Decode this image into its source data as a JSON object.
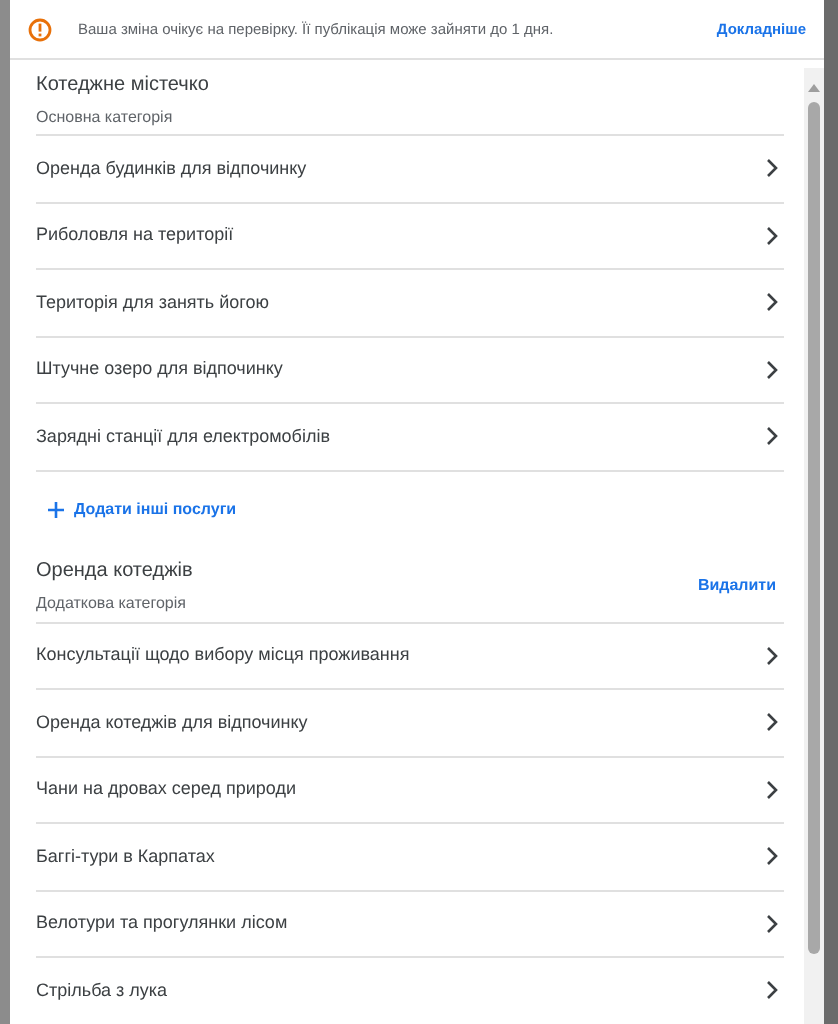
{
  "banner": {
    "message": "Ваша зміна очікує на перевірку. Її публікація може зайняти до 1 дня.",
    "link": "Докладніше"
  },
  "categories": [
    {
      "title": "Котеджне містечко",
      "subtitle": "Основна категорія",
      "services": [
        "Оренда будинків для відпочинку",
        "Риболовля на території",
        "Територія для занять йогою",
        "Штучне озеро для відпочинку",
        "Зарядні станції для електромобілів"
      ],
      "add_link": "Додати інші послуги"
    },
    {
      "title": "Оренда котеджів",
      "subtitle": "Додаткова категорія",
      "action": "Видалити",
      "services": [
        "Консультації щодо вибору місця проживання",
        "Оренда котеджів для відпочинку",
        "Чани на дровах серед природи",
        "Баггі-тури в Карпатах",
        "Велотури та прогулянки лісом",
        "Стрільба з лука"
      ]
    }
  ]
}
